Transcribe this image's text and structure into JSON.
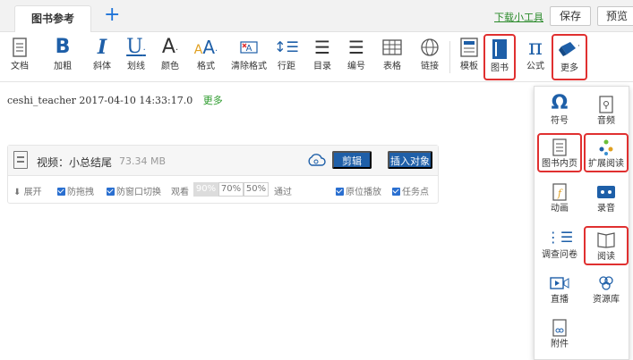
{
  "colors": {
    "accent": "#1e5fa8",
    "highlight": "#e03030",
    "link_green": "#2a8a2a"
  },
  "header": {
    "tab_label": "图书参考",
    "add_tab_icon": "plus-icon",
    "download_link": "下载小工具",
    "save_label": "保存",
    "preview_label": "预览"
  },
  "toolbar": {
    "items": [
      {
        "label": "文档",
        "icon": "document-icon"
      },
      {
        "label": "加粗",
        "icon": "bold-icon"
      },
      {
        "label": "斜体",
        "icon": "italic-icon"
      },
      {
        "label": "划线",
        "icon": "underline-icon"
      },
      {
        "label": "颜色",
        "icon": "font-color-icon"
      },
      {
        "label": "格式",
        "icon": "font-format-icon"
      },
      {
        "label": "清除格式",
        "icon": "clear-format-icon"
      },
      {
        "label": "行距",
        "icon": "line-spacing-icon"
      },
      {
        "label": "目录",
        "icon": "list-icon"
      },
      {
        "label": "编号",
        "icon": "numbered-list-icon"
      },
      {
        "label": "表格",
        "icon": "table-icon"
      },
      {
        "label": "链接",
        "icon": "link-icon"
      },
      {
        "label": "模板",
        "icon": "template-icon"
      },
      {
        "label": "图书",
        "icon": "book-icon"
      },
      {
        "label": "公式",
        "icon": "formula-icon"
      },
      {
        "label": "更多",
        "icon": "more-icon"
      }
    ]
  },
  "meta": {
    "text": "ceshi_teacher 2017-04-10 14:33:17.0",
    "more_link": "更多"
  },
  "media_card": {
    "title": "视频：小总结尾",
    "size": "73.34 MB",
    "edit_label": "剪辑",
    "insert_label": "插入对象",
    "expand_label": "展开",
    "prevent_drag_label": "防拖拽",
    "prevent_switch_label": "防窗口切换",
    "watch_label": "观看",
    "percent_options": [
      "90%",
      "70%",
      "50%"
    ],
    "selected_percent": "90%",
    "pass_label": "通过",
    "resume_label": "原位播放",
    "task_point_label": "任务点"
  },
  "dropdown": {
    "items": [
      {
        "label": "符号",
        "icon": "omega-icon"
      },
      {
        "label": "音频",
        "icon": "audio-file-icon"
      },
      {
        "label": "图书内页",
        "icon": "book-page-icon"
      },
      {
        "label": "扩展阅读",
        "icon": "extended-reading-icon"
      },
      {
        "label": "动画",
        "icon": "animation-icon"
      },
      {
        "label": "录音",
        "icon": "recording-icon"
      },
      {
        "label": "调查问卷",
        "icon": "survey-icon"
      },
      {
        "label": "阅读",
        "icon": "reading-icon"
      },
      {
        "label": "直播",
        "icon": "live-icon"
      },
      {
        "label": "资源库",
        "icon": "resource-library-icon"
      },
      {
        "label": "附件",
        "icon": "attachment-icon"
      }
    ]
  }
}
